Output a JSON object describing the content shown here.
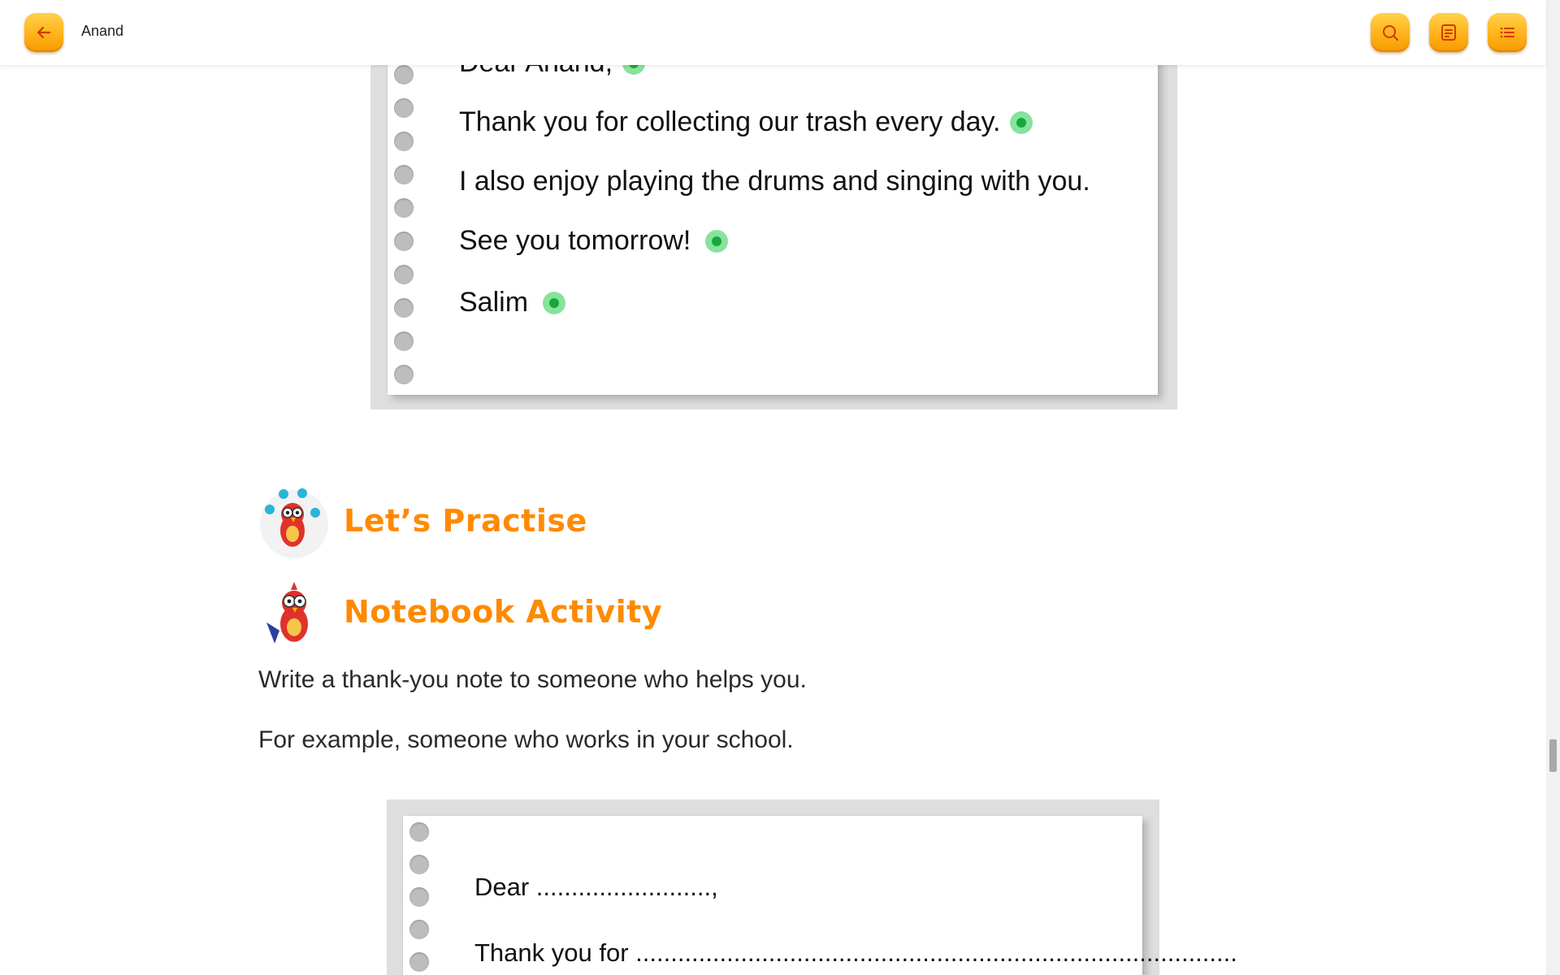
{
  "app": {
    "title": "Anand"
  },
  "toolbar": {
    "back_icon": "arrow-left-icon",
    "search_icon": "search-icon",
    "notes_icon": "notebook-icon",
    "menu_icon": "list-icon",
    "accent_color": "#ffb21a"
  },
  "letter": {
    "lines": [
      "Dear Anand,",
      "Thank you for collecting our trash every day.",
      "I also enjoy playing the drums and singing with you.",
      "See you tomorrow!",
      "Salim"
    ],
    "audio_marker_color": "#1aa63d"
  },
  "practise": {
    "heading": "Let’s Practise"
  },
  "notebook_activity": {
    "heading": "Notebook Activity",
    "instruction": "Write a thank-you note to someone who helps you.",
    "example": "For example, someone who works in your school.",
    "template_lines": [
      "Dear .........................,",
      "Thank you for ......................................................................................"
    ]
  }
}
